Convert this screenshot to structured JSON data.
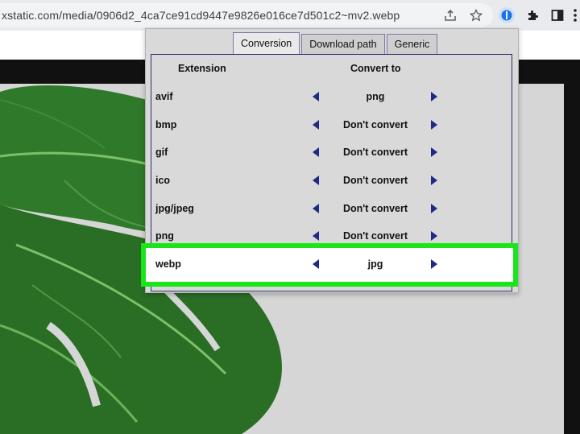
{
  "browser": {
    "url": "xstatic.com/media/0906d2_4ca7ce91cd9447e9826e016ce7d501c2~mv2.webp",
    "toolbar_icons": [
      "share-icon",
      "star-icon",
      "extension-badge-icon",
      "puzzle-icon",
      "side-panel-icon",
      "more-icon"
    ]
  },
  "popup": {
    "tabs": [
      {
        "label": "Conversion",
        "active": true
      },
      {
        "label": "Download path",
        "active": false
      },
      {
        "label": "Generic",
        "active": false
      }
    ],
    "headers": {
      "extension": "Extension",
      "convert_to": "Convert to"
    },
    "rows": [
      {
        "ext": "avif",
        "to": "png"
      },
      {
        "ext": "bmp",
        "to": "Don't convert"
      },
      {
        "ext": "gif",
        "to": "Don't convert"
      },
      {
        "ext": "ico",
        "to": "Don't convert"
      },
      {
        "ext": "jpg/jpeg",
        "to": "Don't convert"
      },
      {
        "ext": "png",
        "to": "Don't convert"
      },
      {
        "ext": "webp",
        "to": "jpg",
        "highlighted": true
      }
    ],
    "colors": {
      "arrow": "#1f2a86",
      "highlight": "#19e619"
    }
  }
}
